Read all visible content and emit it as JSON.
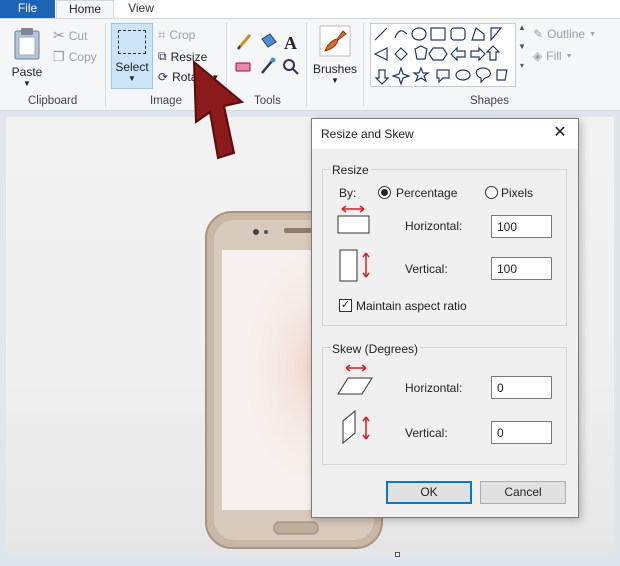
{
  "tabs": {
    "file": "File",
    "home": "Home",
    "view": "View"
  },
  "clipboard": {
    "paste": "Paste",
    "cut": "Cut",
    "copy": "Copy",
    "group": "Clipboard"
  },
  "image": {
    "select": "Select",
    "crop": "Crop",
    "resize": "Resize",
    "rotate": "Rotate",
    "group": "Image"
  },
  "tools": {
    "group": "Tools"
  },
  "brushes": {
    "label": "Brushes"
  },
  "shapes": {
    "outline": "Outline",
    "fill": "Fill",
    "group": "Shapes"
  },
  "dialog": {
    "title": "Resize and Skew",
    "resize_legend": "Resize",
    "by_label": "By:",
    "percentage": "Percentage",
    "pixels": "Pixels",
    "horizontal_label": "Horizontal:",
    "horizontal_value": "100",
    "vertical_label": "Vertical:",
    "vertical_value": "100",
    "maintain_aspect": "Maintain aspect ratio",
    "skew_legend": "Skew (Degrees)",
    "skew_horizontal_label": "Horizontal:",
    "skew_horizontal_value": "0",
    "skew_vertical_label": "Vertical:",
    "skew_vertical_value": "0",
    "ok": "OK",
    "cancel": "Cancel",
    "close": "✕"
  },
  "colors": {
    "accent": "#1e64b4",
    "select_bg": "#cce4f7",
    "arrow": "#8b1a1a",
    "arrow_size_icon": "#cc2222"
  }
}
